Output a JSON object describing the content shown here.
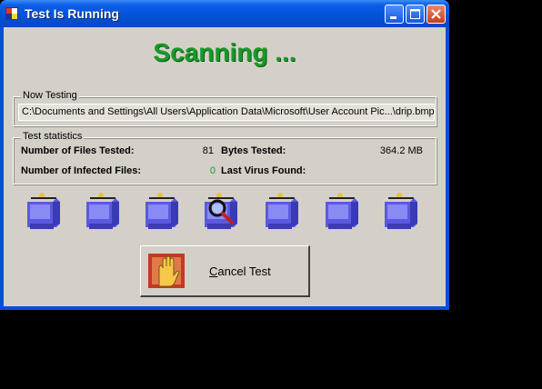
{
  "window": {
    "title": "Test Is Running"
  },
  "status": {
    "heading": "Scanning ..."
  },
  "now_testing": {
    "label": "Now Testing",
    "path": "C:\\Documents and Settings\\All Users\\Application Data\\Microsoft\\User Account Pic...\\drip.bmp"
  },
  "stats": {
    "label": "Test statistics",
    "files_tested_label": "Number of Files Tested:",
    "files_tested_value": "81",
    "bytes_tested_label": "Bytes Tested:",
    "bytes_tested_value": "364.2 MB",
    "infected_label": "Number of Infected Files:",
    "infected_value": "0",
    "last_virus_label": "Last Virus Found:",
    "last_virus_value": ""
  },
  "animation": {
    "computer_icons": [
      "computer-icon",
      "computer-icon",
      "computer-icon",
      "computer-scanning-icon",
      "computer-icon",
      "computer-icon",
      "computer-icon"
    ]
  },
  "buttons": {
    "cancel_label": "Cancel Test",
    "cancel_accel": "C",
    "cancel_rest": "ancel Test"
  },
  "colors": {
    "accent_green": "#159a28",
    "title_blue": "#0352d6",
    "dialog_gray": "#d4d0c8"
  }
}
